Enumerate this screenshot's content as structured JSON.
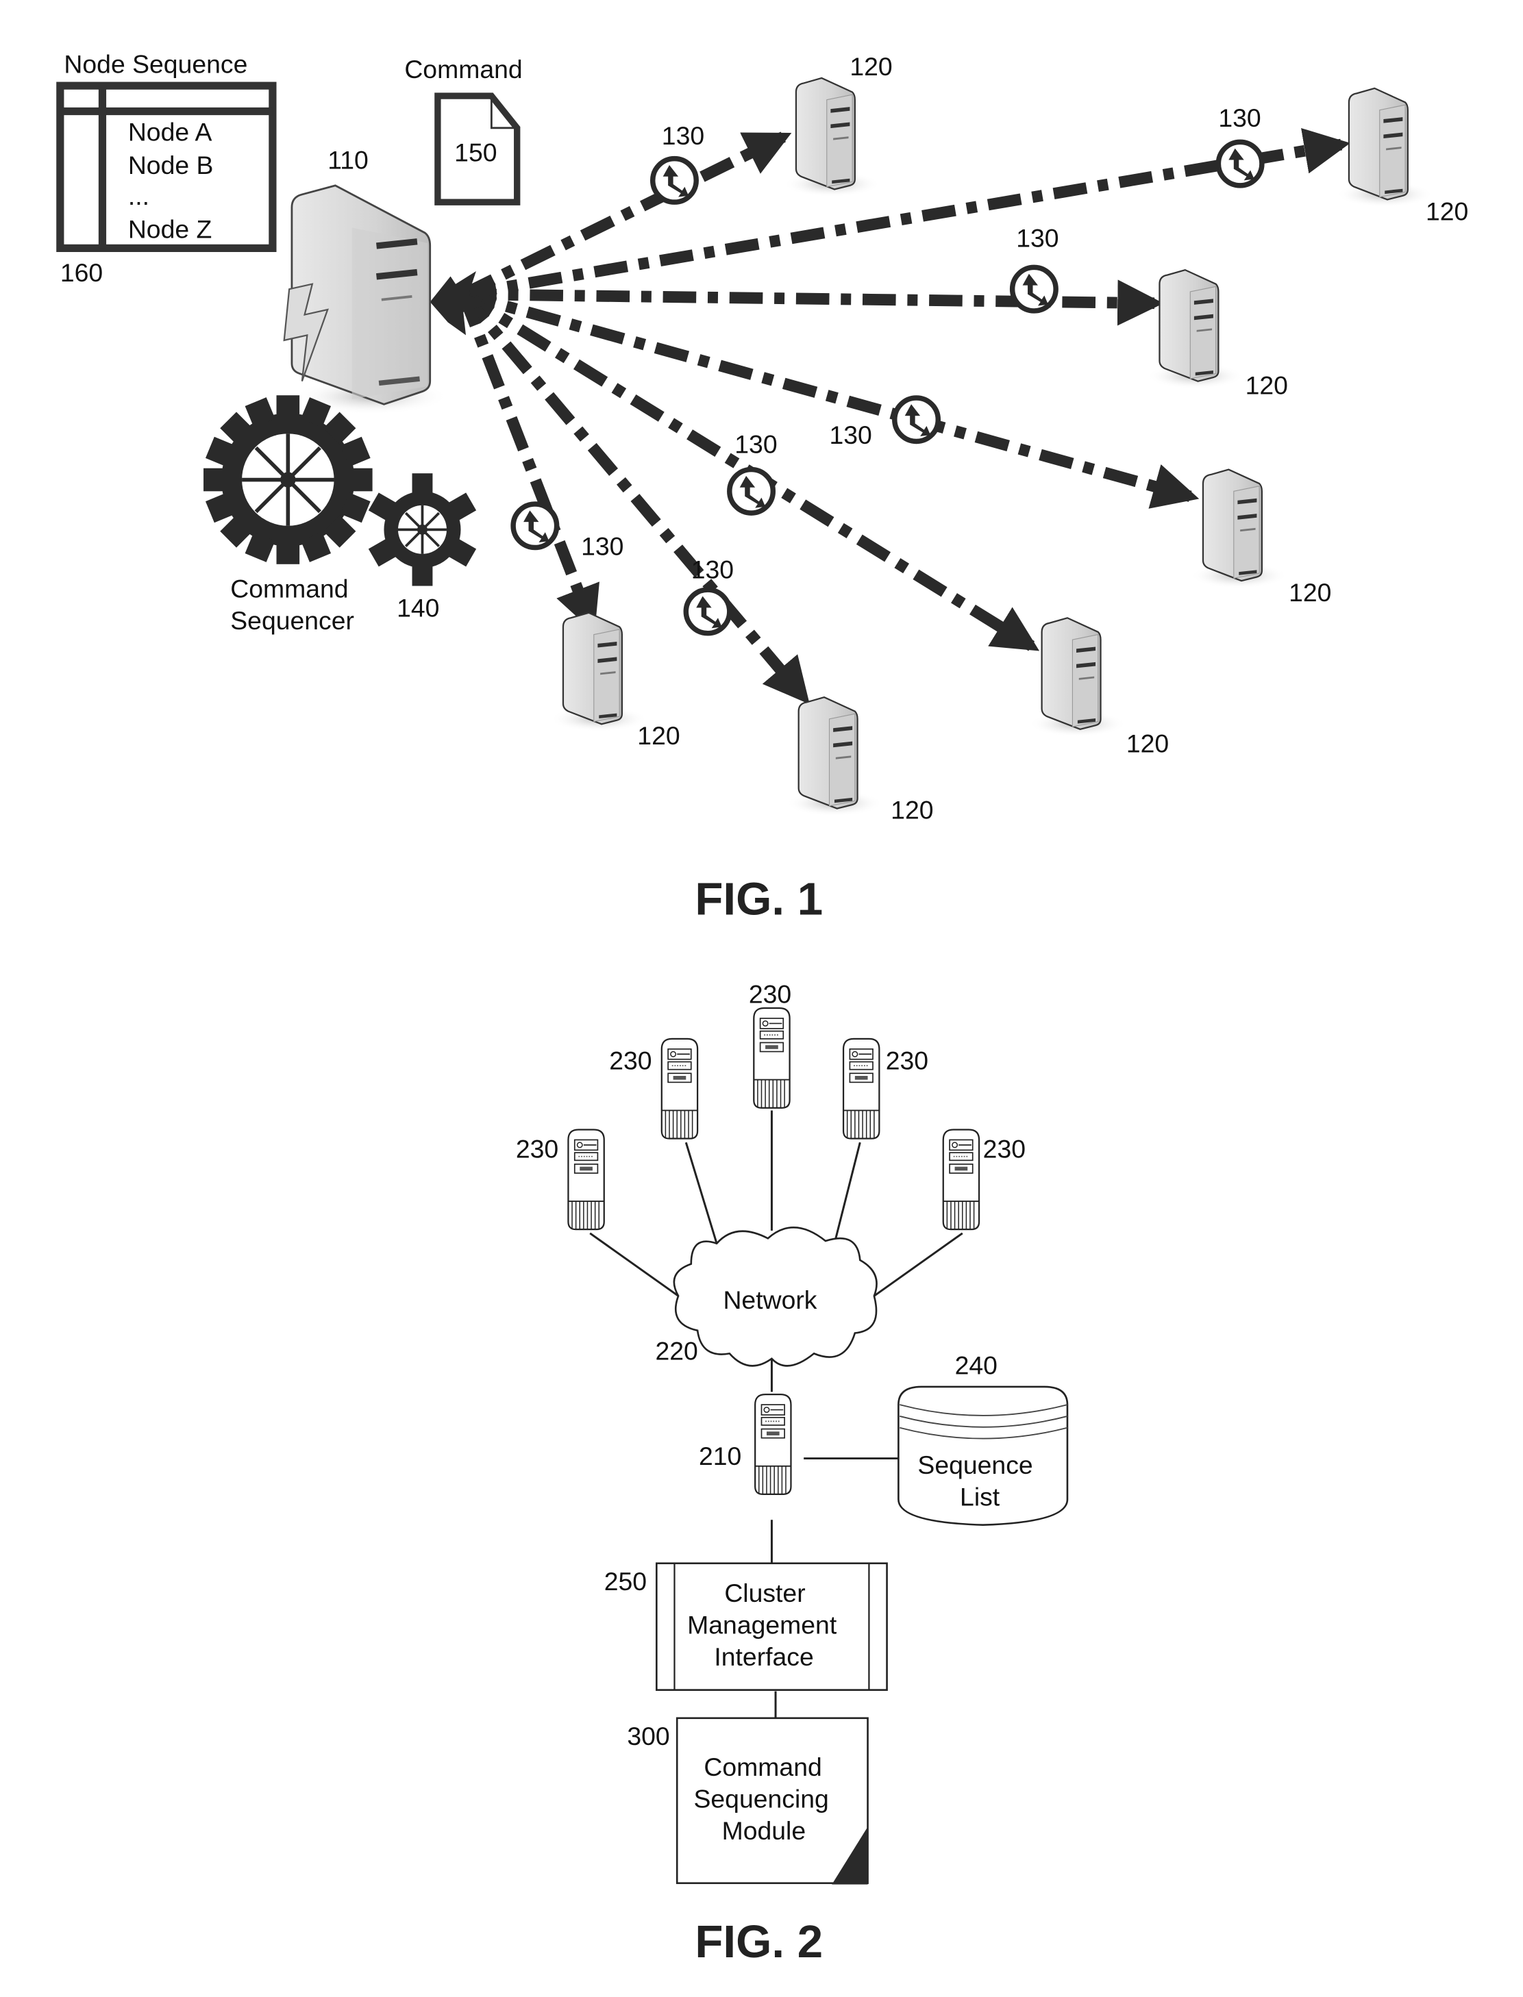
{
  "fig1": {
    "caption": "FIG. 1",
    "node_sequence": {
      "title": "Node Sequence",
      "items": [
        "Node A",
        "Node B",
        "...",
        "Node Z"
      ],
      "ref": "160"
    },
    "command": {
      "title": "Command",
      "ref": "150"
    },
    "controller": {
      "ref": "110"
    },
    "sequencer": {
      "label_line1": "Command",
      "label_line2": "Sequencer",
      "ref": "140"
    },
    "connection_ref": "130",
    "node_ref": "120",
    "nodes": [
      {
        "name": "node-top",
        "ref": "120",
        "conn_ref": "130"
      },
      {
        "name": "node-far-right",
        "ref": "120",
        "conn_ref": "130"
      },
      {
        "name": "node-right-upper",
        "ref": "120",
        "conn_ref": "130"
      },
      {
        "name": "node-right-lower",
        "ref": "120",
        "conn_ref": "130"
      },
      {
        "name": "node-lower-right",
        "ref": "120",
        "conn_ref": "130"
      },
      {
        "name": "node-bottom-center",
        "ref": "120",
        "conn_ref": "130"
      },
      {
        "name": "node-bottom-left",
        "ref": "120",
        "conn_ref": "130"
      }
    ]
  },
  "fig2": {
    "caption": "FIG. 2",
    "network": {
      "label": "Network",
      "ref": "220"
    },
    "cluster_nodes_ref": "230",
    "cluster_nodes": [
      "230",
      "230",
      "230",
      "230",
      "230"
    ],
    "controller": {
      "ref": "210"
    },
    "sequence_list": {
      "line1": "Sequence",
      "line2": "List",
      "ref": "240"
    },
    "cluster_mgmt": {
      "line1": "Cluster",
      "line2": "Management",
      "line3": "Interface",
      "ref": "250"
    },
    "cmd_module": {
      "line1": "Command",
      "line2": "Sequencing",
      "line3": "Module",
      "ref": "300"
    }
  }
}
